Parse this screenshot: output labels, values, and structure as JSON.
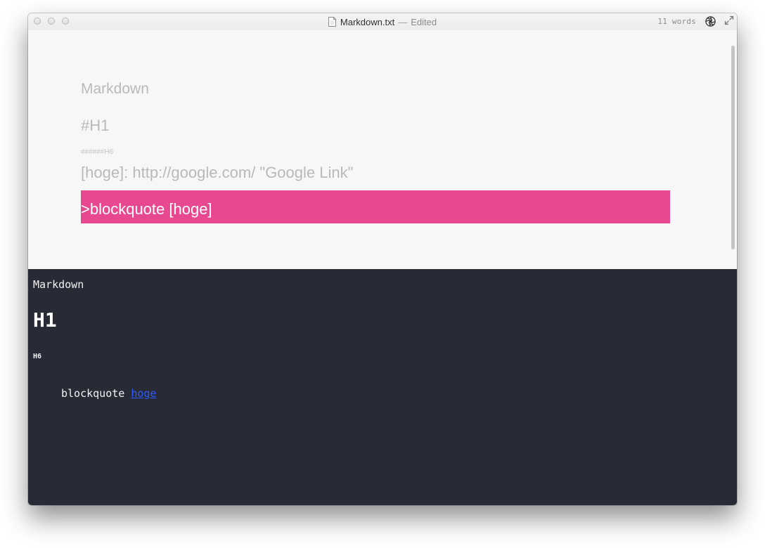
{
  "window": {
    "title": "Markdown.txt",
    "separator": "—",
    "status": "Edited",
    "word_count": "11 words",
    "icons": {
      "document": "document-icon",
      "toggle_preview": "aperture-icon",
      "fullscreen": "fullscreen-icon"
    }
  },
  "editor": {
    "lines": {
      "title": "Markdown",
      "h1": "#H1",
      "h6": "######H6",
      "link_ref": "[hoge]: http://google.com/  \"Google Link\"",
      "blockquote": ">blockquote [hoge]"
    },
    "highlight_color": "#e8488f",
    "background_color": "#f7f7f7",
    "text_color": "#b9b9b9"
  },
  "preview": {
    "paragraph": "Markdown",
    "h1": "H1",
    "h6": "H6",
    "blockquote_text": "blockquote",
    "blockquote_link": "hoge",
    "background_color": "#282a36",
    "link_color": "#2f5bff"
  }
}
